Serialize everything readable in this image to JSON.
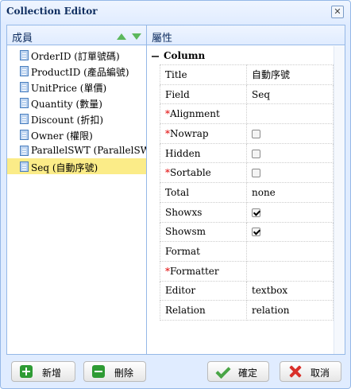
{
  "dialog": {
    "title": "Collection Editor",
    "close_icon": "close-icon"
  },
  "members_panel": {
    "header": "成員",
    "move_up_icon": "arrow-up-icon",
    "move_down_icon": "arrow-down-icon",
    "items": [
      {
        "label": "OrderID (訂單號碼)",
        "selected": false
      },
      {
        "label": "ProductID (產品編號)",
        "selected": false
      },
      {
        "label": "UnitPrice (單價)",
        "selected": false
      },
      {
        "label": "Quantity (數量)",
        "selected": false
      },
      {
        "label": "Discount (折扣)",
        "selected": false
      },
      {
        "label": "Owner (權限)",
        "selected": false
      },
      {
        "label": "ParallelSWT (ParallelSWT)",
        "selected": false
      },
      {
        "label": "Seq (自動序號)",
        "selected": true
      }
    ]
  },
  "properties_panel": {
    "header": "屬性",
    "group": "Column",
    "rows": [
      {
        "name": "Title",
        "required": false,
        "value": "自動序號"
      },
      {
        "name": "Field",
        "required": false,
        "value": "Seq"
      },
      {
        "name": "Alignment",
        "required": true,
        "value": ""
      },
      {
        "name": "Nowrap",
        "required": true,
        "checkbox": false
      },
      {
        "name": "Hidden",
        "required": false,
        "checkbox": false
      },
      {
        "name": "Sortable",
        "required": true,
        "checkbox": false
      },
      {
        "name": "Total",
        "required": false,
        "value": "none"
      },
      {
        "name": "Showxs",
        "required": false,
        "checkbox": true
      },
      {
        "name": "Showsm",
        "required": false,
        "checkbox": true
      },
      {
        "name": "Format",
        "required": false,
        "value": ""
      },
      {
        "name": "Formatter",
        "required": true,
        "value": ""
      },
      {
        "name": "Editor",
        "required": false,
        "value": "textbox"
      },
      {
        "name": "Relation",
        "required": false,
        "value": "relation"
      }
    ]
  },
  "buttons": {
    "add": "新增",
    "remove": "刪除",
    "ok": "確定",
    "cancel": "取消"
  },
  "colors": {
    "border": "#95b8e7",
    "selected_row": "#fbec88",
    "required_mark": "#e00000"
  }
}
